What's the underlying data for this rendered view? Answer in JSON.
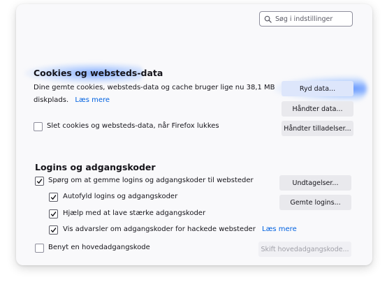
{
  "search": {
    "placeholder": "Søg i indstillinger",
    "icon": "search-icon"
  },
  "cookies": {
    "heading": "Cookies og websteds-data",
    "description_line1": "Dine gemte cookies, websteds-data og cache bruger lige nu 38,1 MB",
    "description_line2": "diskplads.",
    "learn_more": "Læs mere",
    "clear_data_button": "Ryd data...",
    "manage_data_button": "Håndter data...",
    "manage_permissions_button": "Håndter tilladelser...",
    "delete_on_close_label": "Slet cookies og websteds-data, når Firefox lukkes",
    "delete_on_close_checked": false
  },
  "logins": {
    "heading": "Logins og adgangskoder",
    "ask_to_save_label": "Spørg om at gemme logins og adgangskoder til websteder",
    "ask_to_save_checked": true,
    "exceptions_button": "Undtagelser...",
    "autofill_label": "Autofyld logins og adgangskoder",
    "autofill_checked": true,
    "saved_logins_button": "Gemte logins...",
    "suggest_strong_label": "Hjælp med at lave stærke adgangskoder",
    "suggest_strong_checked": true,
    "breach_alerts_label": "Vis advarsler om adgangskoder for hackede websteder",
    "breach_alerts_checked": true,
    "learn_more": "Læs mere",
    "primary_password_label": "Benyt en hovedadgangskode",
    "primary_password_checked": false,
    "change_primary_button": "Skift hovedadgangskode..."
  },
  "colors": {
    "accent": "#0061e0",
    "button_bg": "#e9e9ed",
    "highlight": "#6f9dff"
  }
}
